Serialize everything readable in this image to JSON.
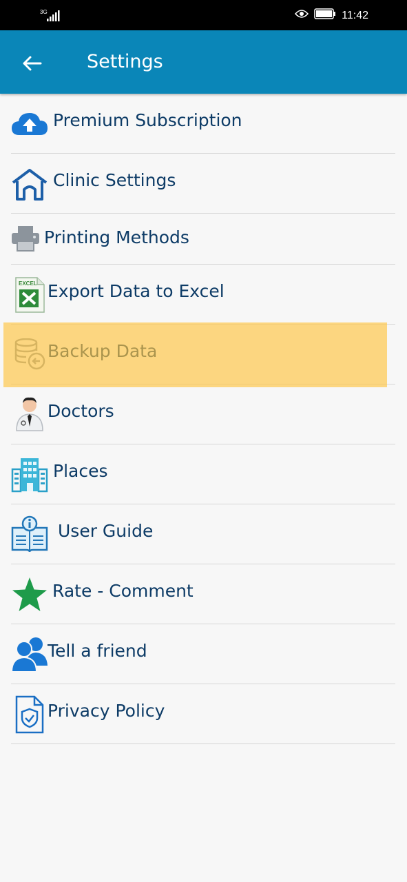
{
  "status_bar": {
    "network": "3G",
    "time": "11:42"
  },
  "app_bar": {
    "title": "Settings"
  },
  "menu": [
    {
      "label": "Premium Subscription"
    },
    {
      "label": "Clinic Settings"
    },
    {
      "label": "Printing Methods"
    },
    {
      "label": "Export Data to Excel"
    },
    {
      "label": "Backup Data"
    },
    {
      "label": "Doctors"
    },
    {
      "label": "Places"
    },
    {
      "label": "User Guide"
    },
    {
      "label": "Rate - Comment"
    },
    {
      "label": "Tell a friend"
    },
    {
      "label": "Privacy Policy"
    }
  ],
  "colors": {
    "app_bar": "#0a86b8",
    "label": "#0d3b66",
    "highlight": "#ffc440"
  }
}
